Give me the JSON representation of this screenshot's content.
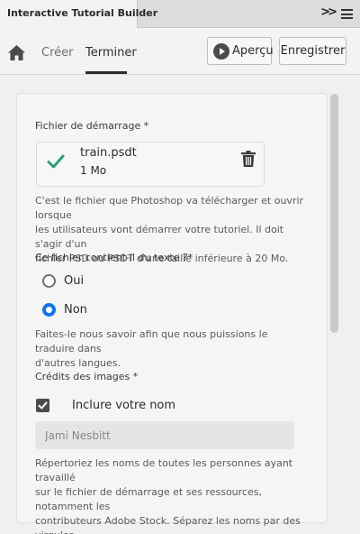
{
  "panel": {
    "title": "Interactive Tutorial Builder",
    "more_glyph": ">>"
  },
  "nav": {
    "create": "Créer",
    "finish": "Terminer",
    "preview_button": "Aperçu",
    "save_button": "Enregistrer"
  },
  "form": {
    "start_file": {
      "label": "Fichier de démarrage *",
      "file_name": "train.psdt",
      "file_size": "1 Mo",
      "help_lines": [
        "C'est le fichier que Photoshop va télécharger et ouvrir lorsque",
        "les utilisateurs vont démarrer votre tutoriel. Il doit s'agir d'un",
        "fichier PSD ou PSDT d'une taille inférieure à 20 Mo."
      ]
    },
    "contains_text": {
      "label": "Ce fichier contient-il du texte ?*",
      "options": [
        "Oui",
        "Non"
      ],
      "selected": "Non",
      "help_lines": [
        "Faites-le nous savoir afin que nous puissions le traduire dans",
        "d'autres langues."
      ]
    },
    "image_credits": {
      "label": "Crédits des images *",
      "include_name_label": "Inclure votre nom",
      "include_name_checked": true,
      "name_value": "Jami Nesbitt",
      "help_lines": [
        "Répertoriez les noms de toutes les personnes ayant travaillé",
        "sur le fichier de démarrage et ses ressources, notamment les",
        "contributeurs Adobe Stock. Séparez les noms par des virgules."
      ]
    }
  },
  "colors": {
    "accent": "#1473e6",
    "check_green": "#2d9d78"
  }
}
